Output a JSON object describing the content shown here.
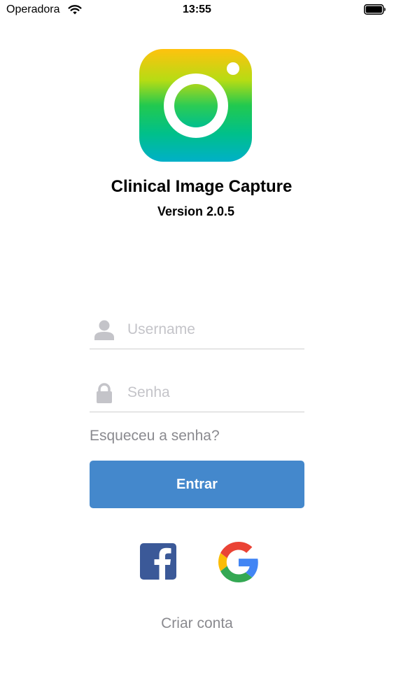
{
  "status_bar": {
    "carrier": "Operadora",
    "time": "13:55",
    "wifi_icon": "wifi-icon",
    "battery_icon": "battery-icon"
  },
  "app": {
    "title": "Clinical Image Capture",
    "version": "Version 2.0.5",
    "logo_icon": "camera-logo-icon"
  },
  "form": {
    "username_placeholder": "Username",
    "username_value": "",
    "password_placeholder": "Senha",
    "password_value": "",
    "forgot_password": "Esqueceu a senha?",
    "login_button": "Entrar"
  },
  "social": {
    "facebook_icon": "facebook-icon",
    "google_icon": "google-icon"
  },
  "create_account": "Criar conta",
  "colors": {
    "accent": "#4488cc",
    "placeholder": "#c4c4c9",
    "link": "#8a8a8f",
    "facebook": "#3b5998"
  }
}
